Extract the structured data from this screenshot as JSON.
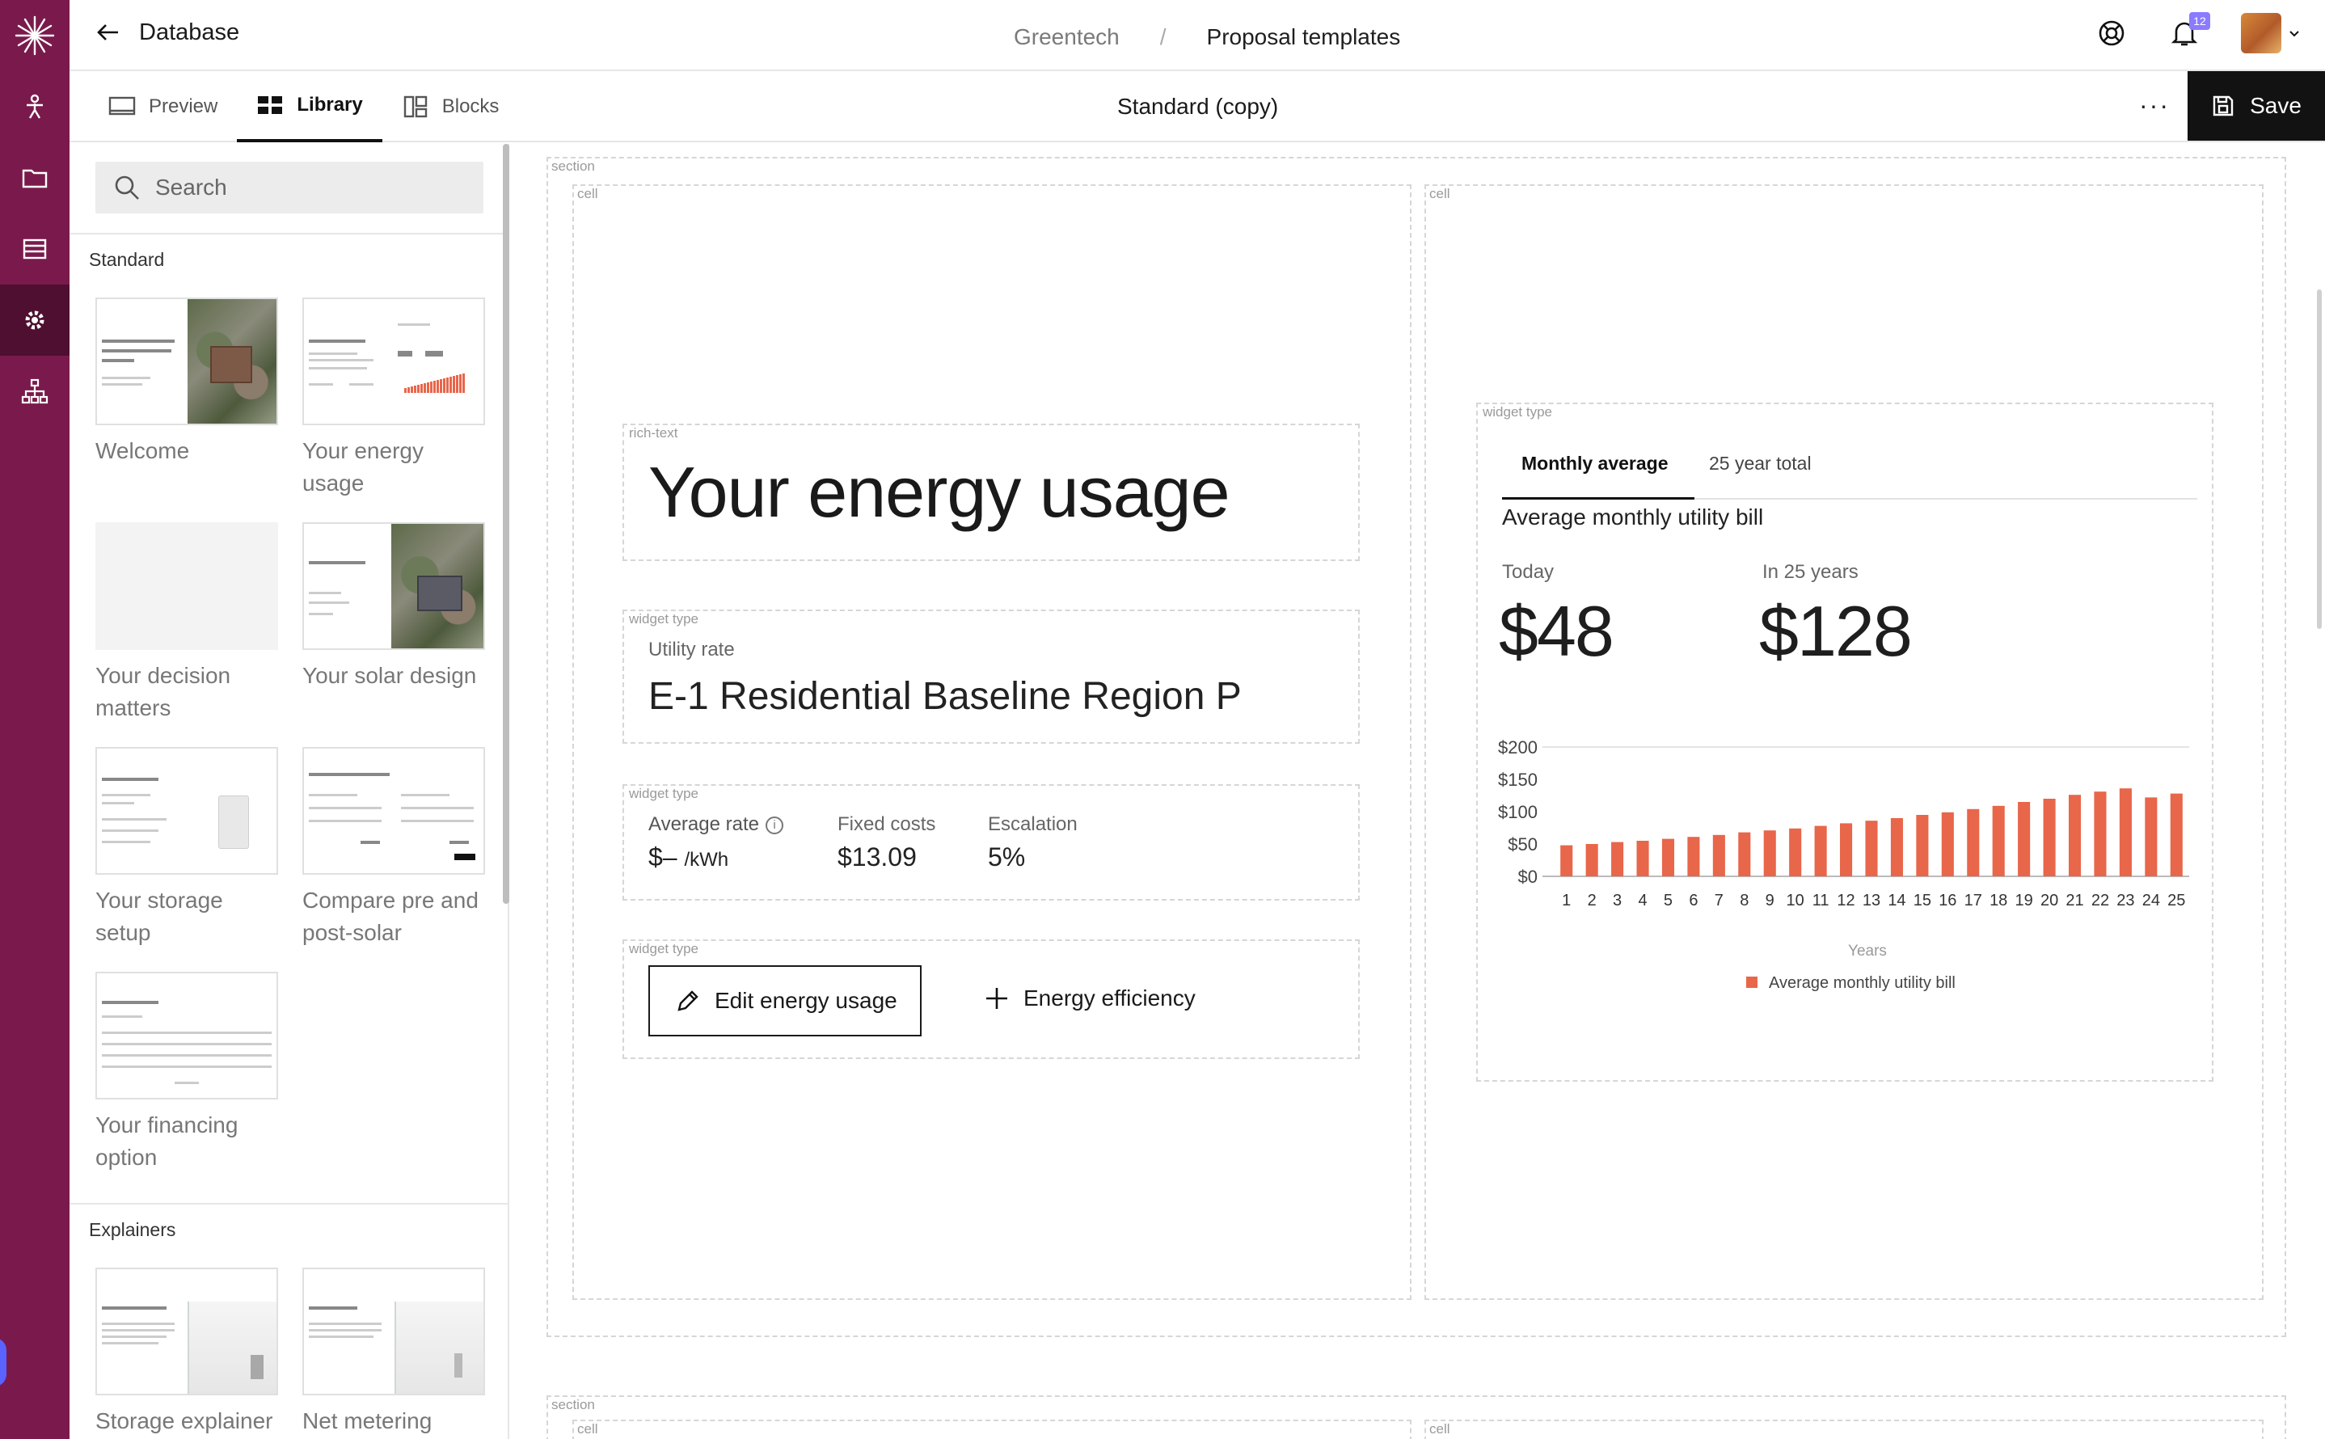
{
  "header": {
    "back_label": "Database",
    "breadcrumb": [
      "Greentech",
      "Proposal templates"
    ],
    "notification_count": "12"
  },
  "toolbar": {
    "tabs": [
      {
        "label": "Preview",
        "icon": "preview-icon"
      },
      {
        "label": "Library",
        "icon": "library-grid-icon"
      },
      {
        "label": "Blocks",
        "icon": "blocks-icon"
      }
    ],
    "active_tab": "Library",
    "document_title": "Standard (copy)",
    "more_label": "···",
    "save_label": "Save"
  },
  "library": {
    "search_placeholder": "Search",
    "groups": [
      {
        "label": "Standard",
        "items": [
          "Welcome",
          "Your energy usage",
          "Your decision matters",
          "Your solar design",
          "Your storage setup",
          "Compare pre and post-solar",
          "Your financing option"
        ]
      },
      {
        "label": "Explainers",
        "items": [
          "Storage explainer",
          "Net metering"
        ]
      }
    ]
  },
  "canvas": {
    "section_tag": "section",
    "cell_tag": "cell",
    "rich_text_tag": "rich-text",
    "widget_tag": "widget type",
    "heading": "Your energy usage",
    "utility_rate": {
      "label": "Utility rate",
      "value": "E-1 Residential Baseline Region P"
    },
    "rates": {
      "average_rate_label": "Average rate",
      "average_rate_value": "$–",
      "average_rate_unit": "/kWh",
      "fixed_costs_label": "Fixed costs",
      "fixed_costs_value": "$13.09",
      "escalation_label": "Escalation",
      "escalation_value": "5%"
    },
    "buttons": {
      "edit": "Edit energy usage",
      "efficiency": "Energy efficiency"
    },
    "bill_widget": {
      "tabs": [
        "Monthly average",
        "25 year total"
      ],
      "title": "Average monthly utility bill",
      "today_label": "Today",
      "today_value": "$48",
      "future_label": "In 25 years",
      "future_value": "$128"
    }
  },
  "chart_data": {
    "type": "bar",
    "categories": [
      "1",
      "2",
      "3",
      "4",
      "5",
      "6",
      "7",
      "8",
      "9",
      "10",
      "11",
      "12",
      "13",
      "14",
      "15",
      "16",
      "17",
      "18",
      "19",
      "20",
      "21",
      "22",
      "23",
      "24",
      "25"
    ],
    "series": [
      {
        "name": "Average monthly utility bill",
        "values": [
          48,
          50,
          53,
          55,
          58,
          61,
          64,
          68,
          71,
          74,
          78,
          82,
          86,
          90,
          95,
          99,
          104,
          109,
          115,
          120,
          126,
          131,
          136,
          122,
          128
        ]
      }
    ],
    "ylim": [
      0,
      200
    ],
    "yticks": [
      "$0",
      "$50",
      "$100",
      "$150",
      "$200"
    ],
    "xlabel": "Years",
    "legend": "bottom",
    "bar_color": "#e8664a"
  }
}
